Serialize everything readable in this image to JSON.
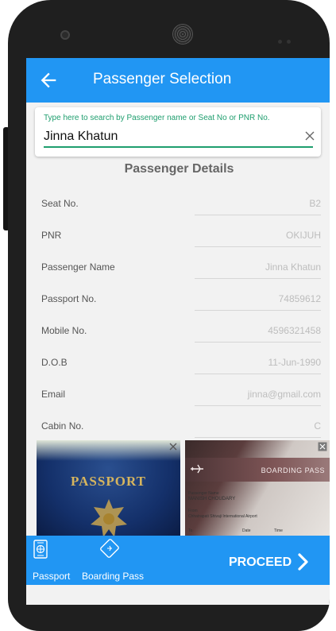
{
  "app_bar": {
    "title": "Passenger Selection"
  },
  "search": {
    "hint": "Type here to search by Passenger name or Seat No or PNR No.",
    "value": "Jinna Khatun"
  },
  "section_title": "Passenger Details",
  "details": [
    {
      "label": "Seat No.",
      "value": "B2"
    },
    {
      "label": "PNR",
      "value": "OKIJUH"
    },
    {
      "label": "Passenger Name",
      "value": "Jinna Khatun"
    },
    {
      "label": "Passport No.",
      "value": "74859612"
    },
    {
      "label": "Mobile No.",
      "value": "4596321458"
    },
    {
      "label": "D.O.B",
      "value": "11-Jun-1990"
    },
    {
      "label": "Email",
      "value": "jinna@gmail.com"
    },
    {
      "label": "Cabin No.",
      "value": "C"
    }
  ],
  "images": {
    "passport_text": "PASSPORT",
    "boarding_title": "BOARDING PASS",
    "boarding_name_label": "Passenger Name",
    "boarding_name": "MANISH CHOUDARY",
    "boarding_from_label": "From",
    "boarding_from": "Chhatrapati Shivaji International Airport",
    "boarding_to_label": "To",
    "boarding_date_label": "Date",
    "boarding_time_label": "Time"
  },
  "bottom_bar": {
    "passport_label": "Passport",
    "boarding_pass_label": "Boarding Pass",
    "proceed_label": "PROCEED"
  },
  "colors": {
    "primary": "#2196f3",
    "accent": "#1e9e6e"
  }
}
